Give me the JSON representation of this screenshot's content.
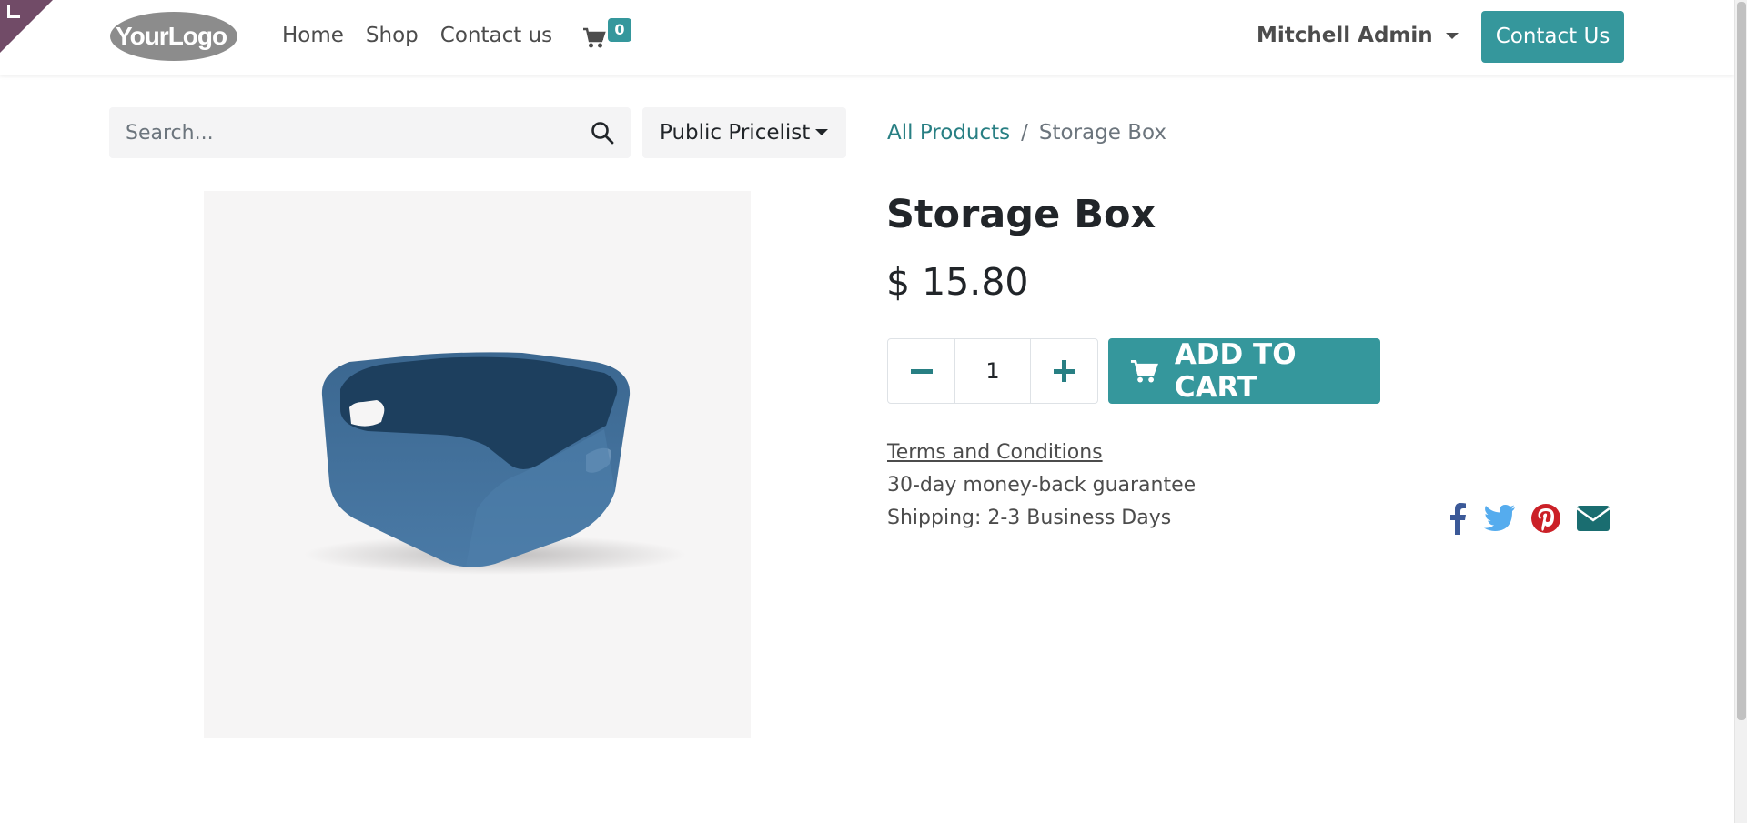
{
  "header": {
    "logo_text": "YourLogo",
    "nav": [
      {
        "label": "Home"
      },
      {
        "label": "Shop"
      },
      {
        "label": "Contact us"
      }
    ],
    "cart_count": "0",
    "user_name": "Mitchell Admin",
    "contact_button": "Contact Us"
  },
  "search": {
    "placeholder": "Search...",
    "pricelist": "Public Pricelist"
  },
  "breadcrumb": {
    "parent": "All Products",
    "separator": "/",
    "current": "Storage Box"
  },
  "product": {
    "name": "Storage Box",
    "price": "$ 15.80",
    "quantity": "1",
    "add_to_cart": "ADD TO CART",
    "terms": "Terms and Conditions",
    "guarantee": "30-day money-back guarantee",
    "shipping": "Shipping: 2-3 Business Days",
    "image_icon": "storage-box-image"
  },
  "social": [
    {
      "icon": "facebook-icon",
      "color": "#3b5998"
    },
    {
      "icon": "twitter-icon",
      "color": "#55acee"
    },
    {
      "icon": "pinterest-icon",
      "color": "#cb2027"
    },
    {
      "icon": "email-icon",
      "color": "#1a6d70"
    }
  ],
  "colors": {
    "accent": "#35979c",
    "link": "#287f83",
    "corner": "#714B67"
  }
}
